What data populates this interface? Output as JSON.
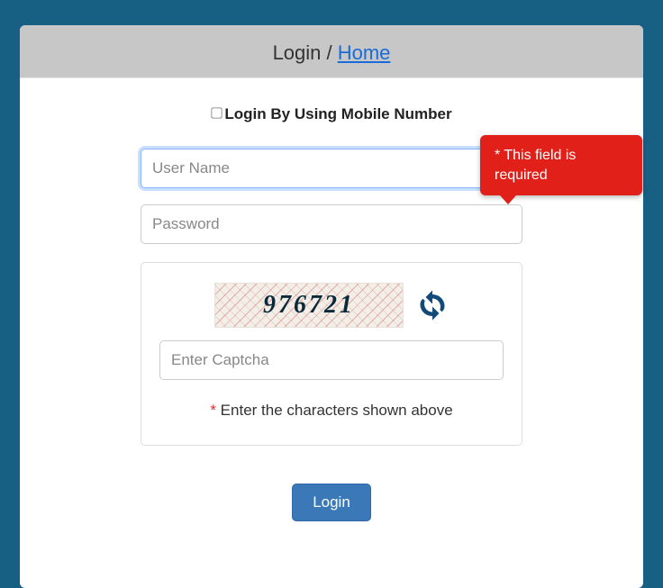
{
  "header": {
    "title_prefix": "Login / ",
    "home_link": "Home"
  },
  "checkbox": {
    "label": "Login By Using Mobile Number"
  },
  "tooltip": {
    "text": "* This field is required"
  },
  "fields": {
    "username_placeholder": "User Name",
    "password_placeholder": "Password"
  },
  "captcha": {
    "value": "976721",
    "input_placeholder": "Enter Captcha",
    "note_star": "*",
    "note_text": " Enter the characters shown above"
  },
  "buttons": {
    "login": "Login"
  }
}
